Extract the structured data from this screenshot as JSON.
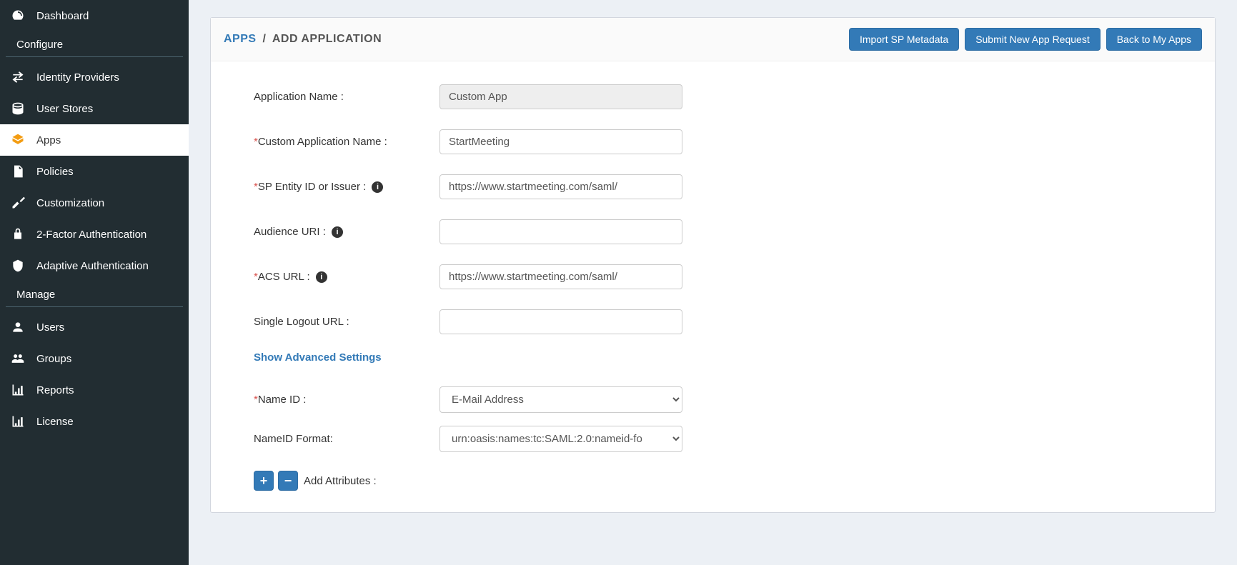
{
  "sidebar": {
    "top": [
      {
        "icon": "dashboard-icon",
        "label": "Dashboard"
      }
    ],
    "configureHeading": "Configure",
    "configure": [
      {
        "icon": "idp-icon",
        "label": "Identity Providers"
      },
      {
        "icon": "userstore-icon",
        "label": "User Stores"
      },
      {
        "icon": "apps-icon",
        "label": "Apps",
        "active": true
      },
      {
        "icon": "policies-icon",
        "label": "Policies"
      },
      {
        "icon": "customization-icon",
        "label": "Customization"
      },
      {
        "icon": "twofa-icon",
        "label": "2-Factor Authentication"
      },
      {
        "icon": "adaptive-icon",
        "label": "Adaptive Authentication"
      }
    ],
    "manageHeading": "Manage",
    "manage": [
      {
        "icon": "users-icon",
        "label": "Users"
      },
      {
        "icon": "groups-icon",
        "label": "Groups"
      },
      {
        "icon": "reports-icon",
        "label": "Reports"
      },
      {
        "icon": "license-icon",
        "label": "License"
      }
    ]
  },
  "breadcrumb": {
    "root": "APPS",
    "sep": "/",
    "current": "ADD APPLICATION"
  },
  "buttons": {
    "importMeta": "Import SP Metadata",
    "submitReq": "Submit New App Request",
    "back": "Back to My Apps"
  },
  "form": {
    "appNameLabel": "Application Name :",
    "appNameValue": "Custom App",
    "customNameLabel": "Custom Application Name :",
    "customNameValue": "StartMeeting",
    "spEntityLabel": "SP Entity ID or Issuer :",
    "spEntityValue": "https://www.startmeeting.com/saml/",
    "audienceLabel": "Audience URI :",
    "audienceValue": "",
    "acsLabel": "ACS URL :",
    "acsValue": "https://www.startmeeting.com/saml/",
    "sloLabel": "Single Logout URL :",
    "sloValue": "",
    "advLink": "Show Advanced Settings",
    "nameIdLabel": "Name ID :",
    "nameIdValue": "E-Mail Address",
    "nameIdFmtLabel": "NameID Format:",
    "nameIdFmtValue": "urn:oasis:names:tc:SAML:2.0:nameid-fo",
    "addAttrLabel": "Add Attributes :"
  }
}
